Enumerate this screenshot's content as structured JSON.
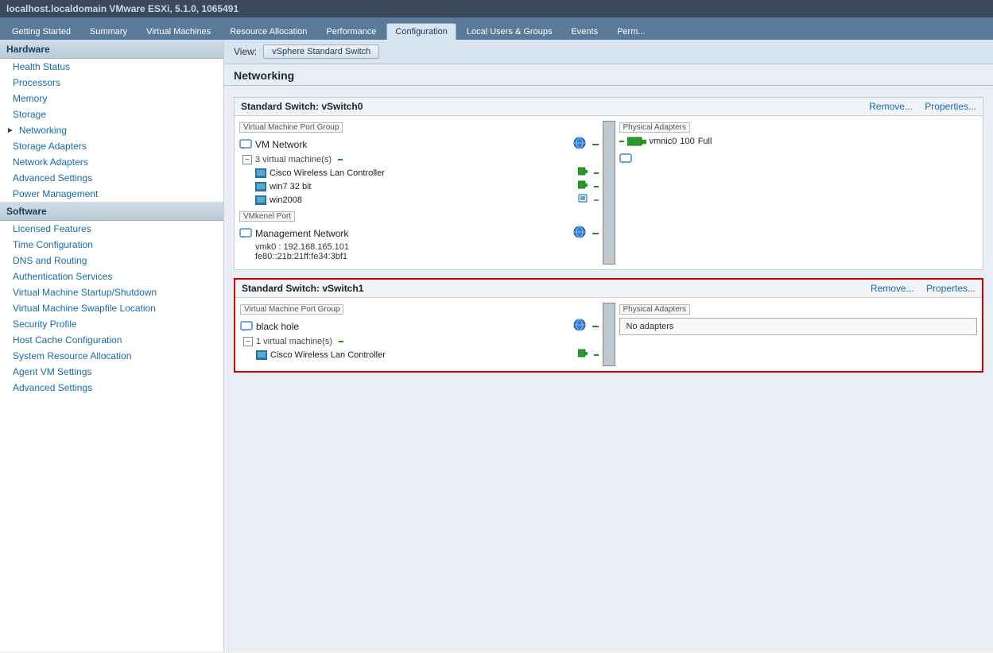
{
  "titlebar": {
    "text": "localhost.localdomain VMware ESXi, 5.1.0, 1065491"
  },
  "tabs": [
    {
      "label": "Getting Started",
      "active": false
    },
    {
      "label": "Summary",
      "active": false
    },
    {
      "label": "Virtual Machines",
      "active": false
    },
    {
      "label": "Resource Allocation",
      "active": false
    },
    {
      "label": "Performance",
      "active": false
    },
    {
      "label": "Configuration",
      "active": true
    },
    {
      "label": "Local Users & Groups",
      "active": false
    },
    {
      "label": "Events",
      "active": false
    },
    {
      "label": "Perm...",
      "active": false
    }
  ],
  "sidebar": {
    "hardware_header": "Hardware",
    "hardware_items": [
      {
        "label": "Health Status",
        "arrow": false
      },
      {
        "label": "Processors",
        "arrow": false
      },
      {
        "label": "Memory",
        "arrow": false
      },
      {
        "label": "Storage",
        "arrow": false
      },
      {
        "label": "Networking",
        "arrow": true,
        "expanded": true
      },
      {
        "label": "Storage Adapters",
        "arrow": false
      },
      {
        "label": "Network Adapters",
        "arrow": false
      },
      {
        "label": "Advanced Settings",
        "arrow": false
      },
      {
        "label": "Power Management",
        "arrow": false
      }
    ],
    "software_header": "Software",
    "software_items": [
      {
        "label": "Licensed Features"
      },
      {
        "label": "Time Configuration"
      },
      {
        "label": "DNS and Routing"
      },
      {
        "label": "Authentication Services"
      },
      {
        "label": "Virtual Machine Startup/Shutdown"
      },
      {
        "label": "Virtual Machine Swapfile Location"
      },
      {
        "label": "Security Profile"
      },
      {
        "label": "Host Cache Configuration"
      },
      {
        "label": "System Resource Allocation"
      },
      {
        "label": "Agent VM Settings"
      },
      {
        "label": "Advanced Settings"
      }
    ]
  },
  "content": {
    "view_label": "View:",
    "view_button": "vSphere Standard Switch",
    "section_title": "Networking",
    "switch0": {
      "title": "Standard Switch: vSwitch0",
      "remove_label": "Remove...",
      "properties_label": "Properties...",
      "highlighted": false,
      "port_group_label": "Virtual Machine Port Group",
      "physical_adapters_label": "Physical Adapters",
      "vmkernel_label": "VMkenel Port",
      "ports": [
        {
          "type": "vm_network",
          "name": "VM Network",
          "vms": [
            "Cisco Wireless Lan Controller",
            "win7 32 bit",
            "win2008"
          ],
          "vm_count": "3 virtual machine(s)"
        }
      ],
      "vmkernel": {
        "name": "Management Network",
        "vmk": "vmk0 : 192.168.165.101",
        "ipv6": "fe80::21b:21ff:fe34:3bf1"
      },
      "adapters": [
        {
          "name": "vmnic0",
          "speed": "100",
          "duplex": "Full"
        }
      ]
    },
    "switch1": {
      "title": "Standard Switch: vSwitch1",
      "remove_label": "Remove...",
      "properties_label": "Propertes...",
      "highlighted": true,
      "port_group_label": "Virtual Machine Port Group",
      "physical_adapters_label": "Physical Adapters",
      "ports": [
        {
          "type": "vm_network",
          "name": "black hole",
          "vms": [
            "Cisco Wireless Lan Controller"
          ],
          "vm_count": "1 virtual machine(s)"
        }
      ],
      "adapters_text": "No adapters"
    }
  }
}
